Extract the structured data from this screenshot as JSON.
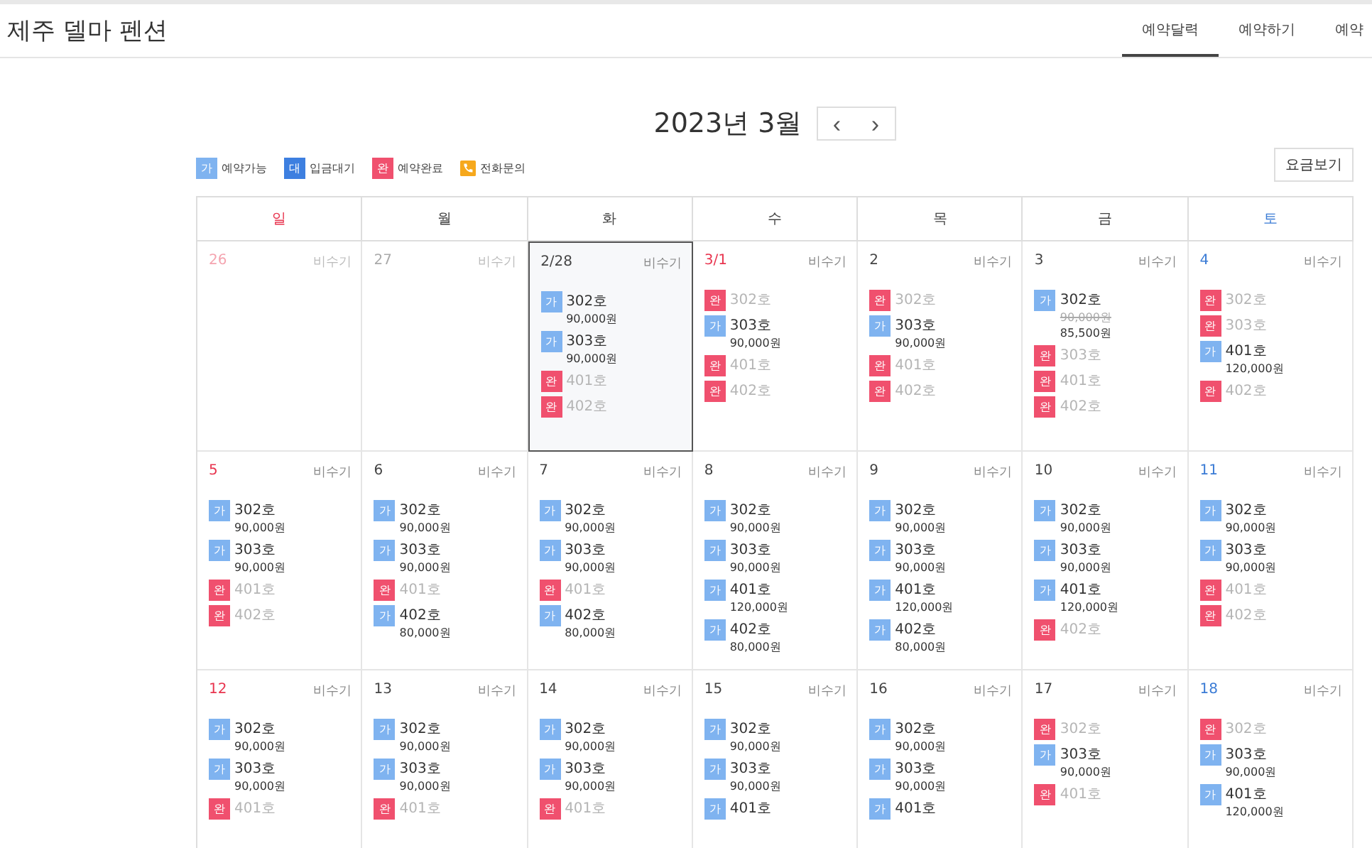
{
  "header": {
    "title": "제주 델마 펜션",
    "tabs": [
      {
        "label": "예약달력",
        "selected": true
      },
      {
        "label": "예약하기",
        "selected": false
      },
      {
        "label": "예약",
        "selected": false
      }
    ]
  },
  "calendar": {
    "month_title": "2023년 3월",
    "prev_button": "‹",
    "next_button": "›",
    "legend": [
      {
        "badge": "가",
        "label": "예약가능",
        "kind": "available"
      },
      {
        "badge": "대",
        "label": "입금대기",
        "kind": "waiting"
      },
      {
        "badge": "완",
        "label": "예약완료",
        "kind": "booked"
      },
      {
        "label": "전화문의",
        "kind": "phone"
      }
    ],
    "rates_button": "요금보기",
    "weekdays": [
      {
        "label": "일",
        "kind": "sunday"
      },
      {
        "label": "월",
        "kind": "weekday"
      },
      {
        "label": "화",
        "kind": "weekday"
      },
      {
        "label": "수",
        "kind": "weekday"
      },
      {
        "label": "목",
        "kind": "weekday"
      },
      {
        "label": "금",
        "kind": "weekday"
      },
      {
        "label": "토",
        "kind": "saturday"
      }
    ],
    "weeks": [
      [
        {
          "date": "26",
          "kind": "sunday",
          "other_month": true,
          "selected": false,
          "season": "비수기"
        },
        {
          "date": "27",
          "kind": "weekday",
          "other_month": true,
          "selected": false,
          "season": "비수기"
        },
        {
          "date": "2/28",
          "kind": "weekday",
          "other_month": false,
          "selected": true,
          "season": "비수기",
          "rooms": [
            {
              "kind": "available",
              "badge": "가",
              "name": "302호",
              "price": "90,000원"
            },
            {
              "kind": "available",
              "badge": "가",
              "name": "303호",
              "price": "90,000원"
            },
            {
              "kind": "booked",
              "badge": "완",
              "name": "401호"
            },
            {
              "kind": "booked",
              "badge": "완",
              "name": "402호"
            }
          ]
        },
        {
          "date": "3/1",
          "kind": "sunday",
          "other_month": false,
          "selected": false,
          "season": "비수기",
          "rooms": [
            {
              "kind": "booked",
              "badge": "완",
              "name": "302호"
            },
            {
              "kind": "available",
              "badge": "가",
              "name": "303호",
              "price": "90,000원"
            },
            {
              "kind": "booked",
              "badge": "완",
              "name": "401호"
            },
            {
              "kind": "booked",
              "badge": "완",
              "name": "402호"
            }
          ]
        },
        {
          "date": "2",
          "kind": "weekday",
          "other_month": false,
          "selected": false,
          "season": "비수기",
          "rooms": [
            {
              "kind": "booked",
              "badge": "완",
              "name": "302호"
            },
            {
              "kind": "available",
              "badge": "가",
              "name": "303호",
              "price": "90,000원"
            },
            {
              "kind": "booked",
              "badge": "완",
              "name": "401호"
            },
            {
              "kind": "booked",
              "badge": "완",
              "name": "402호"
            }
          ]
        },
        {
          "date": "3",
          "kind": "weekday",
          "other_month": false,
          "selected": false,
          "season": "비수기",
          "rooms": [
            {
              "kind": "available",
              "badge": "가",
              "name": "302호",
              "original_price": "90,000원",
              "price": "85,500원"
            },
            {
              "kind": "booked",
              "badge": "완",
              "name": "303호"
            },
            {
              "kind": "booked",
              "badge": "완",
              "name": "401호"
            },
            {
              "kind": "booked",
              "badge": "완",
              "name": "402호"
            }
          ]
        },
        {
          "date": "4",
          "kind": "saturday",
          "other_month": false,
          "selected": false,
          "season": "비수기",
          "rooms": [
            {
              "kind": "booked",
              "badge": "완",
              "name": "302호"
            },
            {
              "kind": "booked",
              "badge": "완",
              "name": "303호"
            },
            {
              "kind": "available",
              "badge": "가",
              "name": "401호",
              "price": "120,000원"
            },
            {
              "kind": "booked",
              "badge": "완",
              "name": "402호"
            }
          ]
        }
      ],
      [
        {
          "date": "5",
          "kind": "sunday",
          "other_month": false,
          "selected": false,
          "season": "비수기",
          "rooms": [
            {
              "kind": "available",
              "badge": "가",
              "name": "302호",
              "price": "90,000원"
            },
            {
              "kind": "available",
              "badge": "가",
              "name": "303호",
              "price": "90,000원"
            },
            {
              "kind": "booked",
              "badge": "완",
              "name": "401호"
            },
            {
              "kind": "booked",
              "badge": "완",
              "name": "402호"
            }
          ]
        },
        {
          "date": "6",
          "kind": "weekday",
          "other_month": false,
          "selected": false,
          "season": "비수기",
          "rooms": [
            {
              "kind": "available",
              "badge": "가",
              "name": "302호",
              "price": "90,000원"
            },
            {
              "kind": "available",
              "badge": "가",
              "name": "303호",
              "price": "90,000원"
            },
            {
              "kind": "booked",
              "badge": "완",
              "name": "401호"
            },
            {
              "kind": "available",
              "badge": "가",
              "name": "402호",
              "price": "80,000원"
            }
          ]
        },
        {
          "date": "7",
          "kind": "weekday",
          "other_month": false,
          "selected": false,
          "season": "비수기",
          "rooms": [
            {
              "kind": "available",
              "badge": "가",
              "name": "302호",
              "price": "90,000원"
            },
            {
              "kind": "available",
              "badge": "가",
              "name": "303호",
              "price": "90,000원"
            },
            {
              "kind": "booked",
              "badge": "완",
              "name": "401호"
            },
            {
              "kind": "available",
              "badge": "가",
              "name": "402호",
              "price": "80,000원"
            }
          ]
        },
        {
          "date": "8",
          "kind": "weekday",
          "other_month": false,
          "selected": false,
          "season": "비수기",
          "rooms": [
            {
              "kind": "available",
              "badge": "가",
              "name": "302호",
              "price": "90,000원"
            },
            {
              "kind": "available",
              "badge": "가",
              "name": "303호",
              "price": "90,000원"
            },
            {
              "kind": "available",
              "badge": "가",
              "name": "401호",
              "price": "120,000원"
            },
            {
              "kind": "available",
              "badge": "가",
              "name": "402호",
              "price": "80,000원"
            }
          ]
        },
        {
          "date": "9",
          "kind": "weekday",
          "other_month": false,
          "selected": false,
          "season": "비수기",
          "rooms": [
            {
              "kind": "available",
              "badge": "가",
              "name": "302호",
              "price": "90,000원"
            },
            {
              "kind": "available",
              "badge": "가",
              "name": "303호",
              "price": "90,000원"
            },
            {
              "kind": "available",
              "badge": "가",
              "name": "401호",
              "price": "120,000원"
            },
            {
              "kind": "available",
              "badge": "가",
              "name": "402호",
              "price": "80,000원"
            }
          ]
        },
        {
          "date": "10",
          "kind": "weekday",
          "other_month": false,
          "selected": false,
          "season": "비수기",
          "rooms": [
            {
              "kind": "available",
              "badge": "가",
              "name": "302호",
              "price": "90,000원"
            },
            {
              "kind": "available",
              "badge": "가",
              "name": "303호",
              "price": "90,000원"
            },
            {
              "kind": "available",
              "badge": "가",
              "name": "401호",
              "price": "120,000원"
            },
            {
              "kind": "booked",
              "badge": "완",
              "name": "402호"
            }
          ]
        },
        {
          "date": "11",
          "kind": "saturday",
          "other_month": false,
          "selected": false,
          "season": "비수기",
          "rooms": [
            {
              "kind": "available",
              "badge": "가",
              "name": "302호",
              "price": "90,000원"
            },
            {
              "kind": "available",
              "badge": "가",
              "name": "303호",
              "price": "90,000원"
            },
            {
              "kind": "booked",
              "badge": "완",
              "name": "401호"
            },
            {
              "kind": "booked",
              "badge": "완",
              "name": "402호"
            }
          ]
        }
      ],
      [
        {
          "date": "12",
          "kind": "sunday",
          "other_month": false,
          "selected": false,
          "season": "비수기",
          "rooms": [
            {
              "kind": "available",
              "badge": "가",
              "name": "302호",
              "price": "90,000원"
            },
            {
              "kind": "available",
              "badge": "가",
              "name": "303호",
              "price": "90,000원"
            },
            {
              "kind": "booked",
              "badge": "완",
              "name": "401호"
            }
          ]
        },
        {
          "date": "13",
          "kind": "weekday",
          "other_month": false,
          "selected": false,
          "season": "비수기",
          "rooms": [
            {
              "kind": "available",
              "badge": "가",
              "name": "302호",
              "price": "90,000원"
            },
            {
              "kind": "available",
              "badge": "가",
              "name": "303호",
              "price": "90,000원"
            },
            {
              "kind": "booked",
              "badge": "완",
              "name": "401호"
            }
          ]
        },
        {
          "date": "14",
          "kind": "weekday",
          "other_month": false,
          "selected": false,
          "season": "비수기",
          "rooms": [
            {
              "kind": "available",
              "badge": "가",
              "name": "302호",
              "price": "90,000원"
            },
            {
              "kind": "available",
              "badge": "가",
              "name": "303호",
              "price": "90,000원"
            },
            {
              "kind": "booked",
              "badge": "완",
              "name": "401호"
            }
          ]
        },
        {
          "date": "15",
          "kind": "weekday",
          "other_month": false,
          "selected": false,
          "season": "비수기",
          "rooms": [
            {
              "kind": "available",
              "badge": "가",
              "name": "302호",
              "price": "90,000원"
            },
            {
              "kind": "available",
              "badge": "가",
              "name": "303호",
              "price": "90,000원"
            },
            {
              "kind": "available",
              "badge": "가",
              "name": "401호"
            }
          ]
        },
        {
          "date": "16",
          "kind": "weekday",
          "other_month": false,
          "selected": false,
          "season": "비수기",
          "rooms": [
            {
              "kind": "available",
              "badge": "가",
              "name": "302호",
              "price": "90,000원"
            },
            {
              "kind": "available",
              "badge": "가",
              "name": "303호",
              "price": "90,000원"
            },
            {
              "kind": "available",
              "badge": "가",
              "name": "401호"
            }
          ]
        },
        {
          "date": "17",
          "kind": "weekday",
          "other_month": false,
          "selected": false,
          "season": "비수기",
          "rooms": [
            {
              "kind": "booked",
              "badge": "완",
              "name": "302호"
            },
            {
              "kind": "available",
              "badge": "가",
              "name": "303호",
              "price": "90,000원"
            },
            {
              "kind": "booked",
              "badge": "완",
              "name": "401호"
            }
          ]
        },
        {
          "date": "18",
          "kind": "saturday",
          "other_month": false,
          "selected": false,
          "season": "비수기",
          "rooms": [
            {
              "kind": "booked",
              "badge": "완",
              "name": "302호"
            },
            {
              "kind": "available",
              "badge": "가",
              "name": "303호",
              "price": "90,000원"
            },
            {
              "kind": "available",
              "badge": "가",
              "name": "401호",
              "price": "120,000원"
            }
          ]
        }
      ]
    ]
  }
}
